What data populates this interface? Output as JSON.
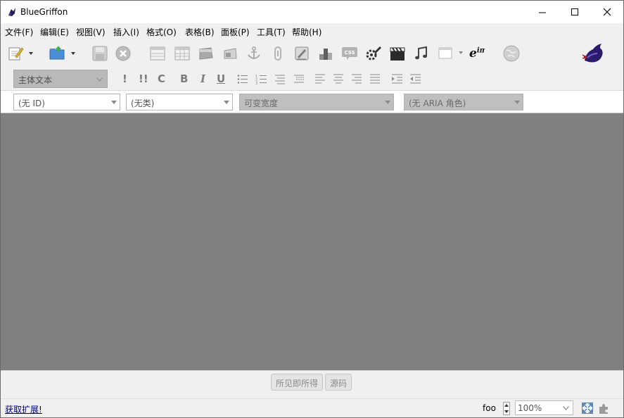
{
  "window": {
    "title": "BlueGriffon"
  },
  "menu": [
    {
      "label": "文件(F)"
    },
    {
      "label": "编辑(E)"
    },
    {
      "label": "视图(V)"
    },
    {
      "label": "插入(I)"
    },
    {
      "label": "格式(O)"
    },
    {
      "label": "表格(B)"
    },
    {
      "label": "面板(P)"
    },
    {
      "label": "工具(T)"
    },
    {
      "label": "帮助(H)"
    }
  ],
  "format_toolbar": {
    "paragraph_format": "主体文本",
    "em_label": "!",
    "strong_label": "!!",
    "code_label": "C",
    "bold_label": "B",
    "italic_label": "I",
    "underline_label": "U"
  },
  "toolbar1": {
    "math_label": "e",
    "math_sup": "iπ",
    "css_label": "CSS"
  },
  "attr_toolbar": {
    "id_value": "(无 ID)",
    "class_value": "(无类)",
    "width_value": "可变宽度",
    "aria_value": "(无 ARIA 角色)"
  },
  "view_tabs": [
    {
      "label": "所见即所得"
    },
    {
      "label": "源码"
    }
  ],
  "status": {
    "extensions_link": "获取扩展!",
    "foo_label": "foo",
    "zoom_value": "100%"
  }
}
